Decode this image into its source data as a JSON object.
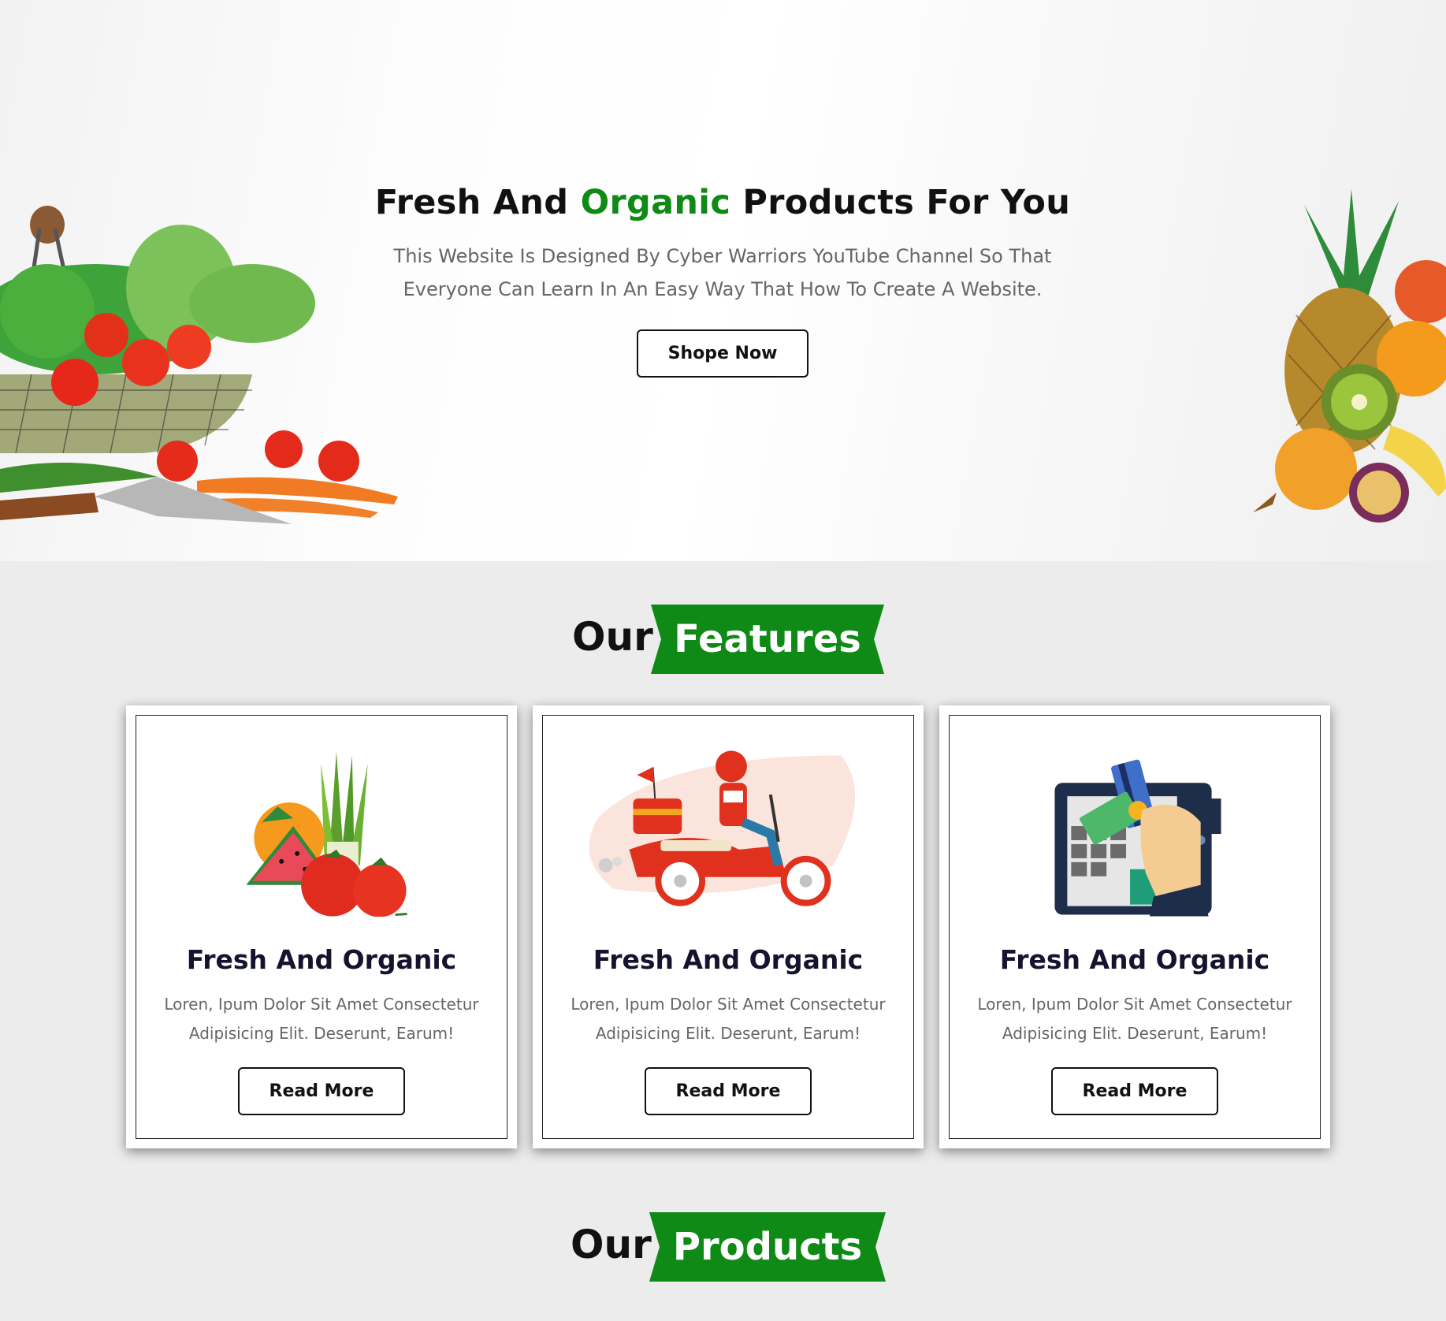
{
  "hero": {
    "title_part1": "Fresh And ",
    "title_accent": "Organic",
    "title_part2": " Products For You",
    "description_line1": "This Website Is Designed By Cyber Warriors YouTube Channel So That",
    "description_line2": "Everyone Can Learn In An Easy Way That How To Create A Website.",
    "button_label": "Shope Now"
  },
  "features_heading": {
    "plain": "Our",
    "ribbon": "Features"
  },
  "features": [
    {
      "title": "Fresh And Organic",
      "text_line1": "Loren, Ipum Dolor Sit Amet Consectetur",
      "text_line2": "Adipisicing Elit. Deserunt, Earum!",
      "button_label": "Read More",
      "icon": "fruits-vegetables-icon"
    },
    {
      "title": "Fresh And Organic",
      "text_line1": "Loren, Ipum Dolor Sit Amet Consectetur",
      "text_line2": "Adipisicing Elit. Deserunt, Earum!",
      "button_label": "Read More",
      "icon": "delivery-scooter-icon"
    },
    {
      "title": "Fresh And Organic",
      "text_line1": "Loren, Ipum Dolor Sit Amet Consectetur",
      "text_line2": "Adipisicing Elit. Deserunt, Earum!",
      "button_label": "Read More",
      "icon": "card-payment-icon"
    }
  ],
  "products_heading": {
    "plain": "Our",
    "ribbon": "Products"
  },
  "colors": {
    "accent_green": "#0f8a17",
    "text_dark": "#111111",
    "page_bg": "#ececec"
  }
}
